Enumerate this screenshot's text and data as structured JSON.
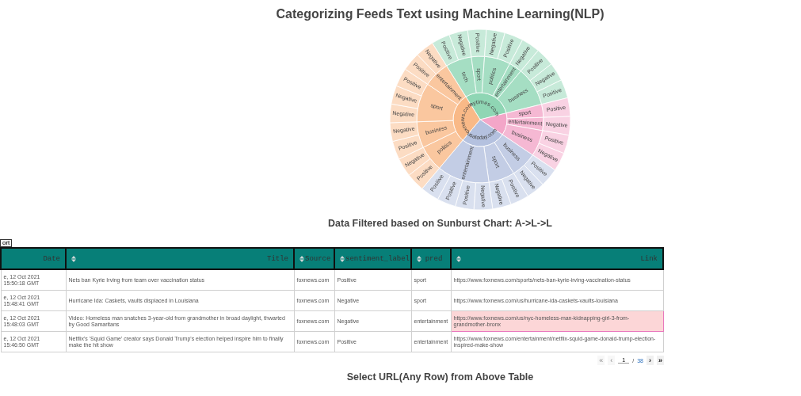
{
  "title": "Categorizing Feeds Text using Machine Learning(NLP)",
  "sunburst": [
    {
      "name": "nytimes.com",
      "color": "#8fd6b4",
      "children": [
        {
          "name": "tech",
          "children": [
            "Positive",
            "Negative"
          ]
        },
        {
          "name": "sport",
          "children": [
            "Positive"
          ]
        },
        {
          "name": "politics",
          "children": [
            "Negative",
            "Positive"
          ]
        },
        {
          "name": "entertainment",
          "children": [
            "Negative"
          ]
        },
        {
          "name": "business",
          "children": [
            "Positive",
            "Negative",
            "Positive"
          ]
        }
      ]
    },
    {
      "color": "#f3a6c8",
      "children": [
        {
          "name": "sport",
          "children": [
            "Positive"
          ]
        },
        {
          "name": "entertainment",
          "children": [
            "Negative"
          ]
        },
        {
          "name": "business",
          "children": [
            "Positive",
            "Negative"
          ]
        }
      ]
    },
    {
      "name": "usatoday.com",
      "color": "#b4c1df",
      "children": [
        {
          "name": "business",
          "children": [
            "Positive",
            "Negative"
          ]
        },
        {
          "name": "sport",
          "children": [
            "Positive",
            "Negative"
          ]
        },
        {
          "name": "entertainment",
          "children": [
            "Negative",
            "Positive",
            "Positive",
            "Positive"
          ]
        }
      ]
    },
    {
      "name": "foxnews.com",
      "color": "#f9b987",
      "children": [
        {
          "name": "politics",
          "children": [
            "Positive",
            "Negative"
          ]
        },
        {
          "name": "business",
          "children": [
            "Positive",
            "Negative"
          ]
        },
        {
          "name": "sport",
          "children": [
            "Negative",
            "Negative",
            "Positive"
          ]
        },
        {
          "name": "entertainment",
          "children": [
            "Positive",
            "Negative"
          ]
        }
      ]
    }
  ],
  "subtitle": "Data Filtered based on Sunburst Chart: A->L->L",
  "export_button": "ort",
  "table": {
    "columns": [
      {
        "label": "Date",
        "sortable": false
      },
      {
        "label": "Title",
        "sortable": true
      },
      {
        "label": "Source",
        "sortable": true
      },
      {
        "label": "sentiment_label",
        "sortable": true
      },
      {
        "label": "pred",
        "sortable": true
      },
      {
        "label": "Link",
        "sortable": true
      }
    ],
    "rows": [
      {
        "selected": false,
        "cells": [
          "e, 12 Oct 2021 15:50:18 GMT",
          "Nets ban Kyrie Irving from team over vaccination status",
          "foxnews.com",
          "Positive",
          "sport",
          "https://www.foxnews.com/sports/nets-ban-kyrie-irving-vaccination-status"
        ]
      },
      {
        "selected": false,
        "cells": [
          "e, 12 Oct 2021 15:48:41 GMT",
          "Hurricane Ida: Caskets, vaults displaced in Louisiana",
          "foxnews.com",
          "Negative",
          "sport",
          "https://www.foxnews.com/us/hurricane-ida-caskets-vaults-louisiana"
        ]
      },
      {
        "selected": true,
        "cells": [
          "e, 12 Oct 2021 15:48:03 GMT",
          "Video: Homeless man snatches 3-year-old from grandmother in broad daylight, thwarted by Good Samaritans",
          "foxnews.com",
          "Negative",
          "entertainment",
          "https://www.foxnews.com/us/nyc-homeless-man-kidnapping-girl-3-from-grandmother-bronx"
        ]
      },
      {
        "selected": false,
        "cells": [
          "e, 12 Oct 2021 15:46:50 GMT",
          "Netflix's 'Squid Game' creator says Donald Trump's election helped inspire him to finally make the hit show",
          "foxnews.com",
          "Positive",
          "entertainment",
          "https://www.foxnews.com/entertainment/netflix-squid-game-donald-trump-election-inspired-make-show"
        ]
      }
    ]
  },
  "pagination": {
    "first": {
      "label": "«",
      "disabled": true
    },
    "previous": {
      "label": "‹",
      "disabled": true
    },
    "page": "1",
    "separator": "/",
    "total": "38",
    "next": {
      "label": "›",
      "disabled": false
    },
    "last": {
      "label": "»",
      "disabled": false
    }
  },
  "footer_heading": "Select URL(Any Row) from Above Table"
}
